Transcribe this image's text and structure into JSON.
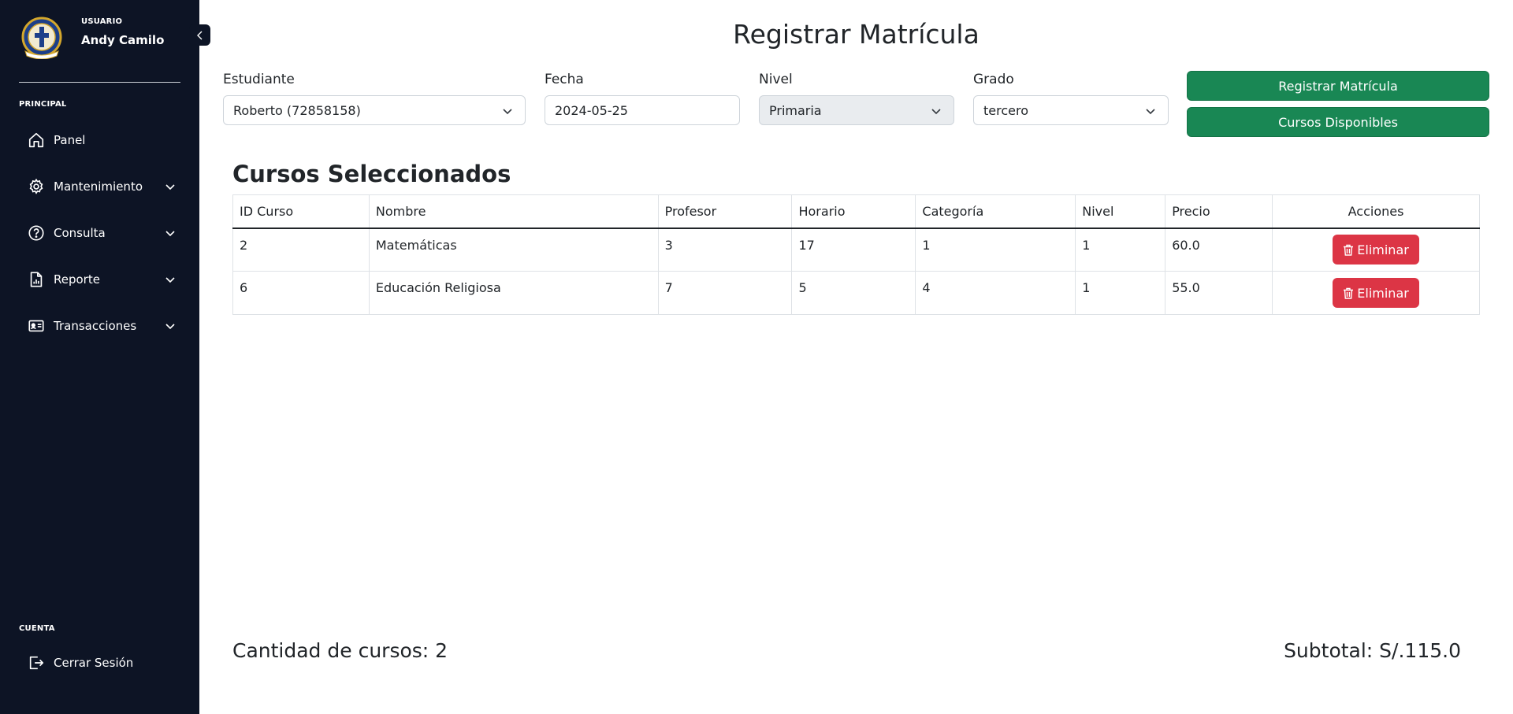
{
  "sidebar": {
    "user_caption": "USUARIO",
    "user_name": "Andy Camilo",
    "section_principal": "PRINCIPAL",
    "items": [
      {
        "label": "Panel",
        "icon": "home-icon"
      },
      {
        "label": "Mantenimiento",
        "icon": "gear-icon"
      },
      {
        "label": "Consulta",
        "icon": "question-circle-icon"
      },
      {
        "label": "Reporte",
        "icon": "report-icon"
      },
      {
        "label": "Transacciones",
        "icon": "id-card-icon"
      }
    ],
    "section_cuenta": "CUENTA",
    "logout_label": "Cerrar Sesión",
    "background": "#0d1425"
  },
  "page": {
    "title": "Registrar Matrícula"
  },
  "form": {
    "student_label": "Estudiante",
    "student_value": "Roberto (72858158)",
    "date_label": "Fecha",
    "date_value": "2024-05-25",
    "level_label": "Nivel",
    "level_value": "Primaria",
    "grade_label": "Grado",
    "grade_value": "tercero"
  },
  "actions": {
    "register_label": "Registrar Matrícula",
    "available_label": "Cursos Disponibles",
    "accent": "#198754",
    "danger": "#dc3545"
  },
  "selected": {
    "title": "Cursos Seleccionados",
    "columns": [
      "ID Curso",
      "Nombre",
      "Profesor",
      "Horario",
      "Categoría",
      "Nivel",
      "Precio",
      "Acciones"
    ],
    "rows": [
      {
        "id": "2",
        "nombre": "Matemáticas",
        "profesor": "3",
        "horario": "17",
        "categoria": "1",
        "nivel": "1",
        "precio": "60.0",
        "action": "Eliminar"
      },
      {
        "id": "6",
        "nombre": "Educación Religiosa",
        "profesor": "7",
        "horario": "5",
        "categoria": "4",
        "nivel": "1",
        "precio": "55.0",
        "action": "Eliminar"
      }
    ]
  },
  "summary": {
    "count_text": "Cantidad de cursos: 2",
    "subtotal_text": "Subtotal: S/.115.0"
  }
}
